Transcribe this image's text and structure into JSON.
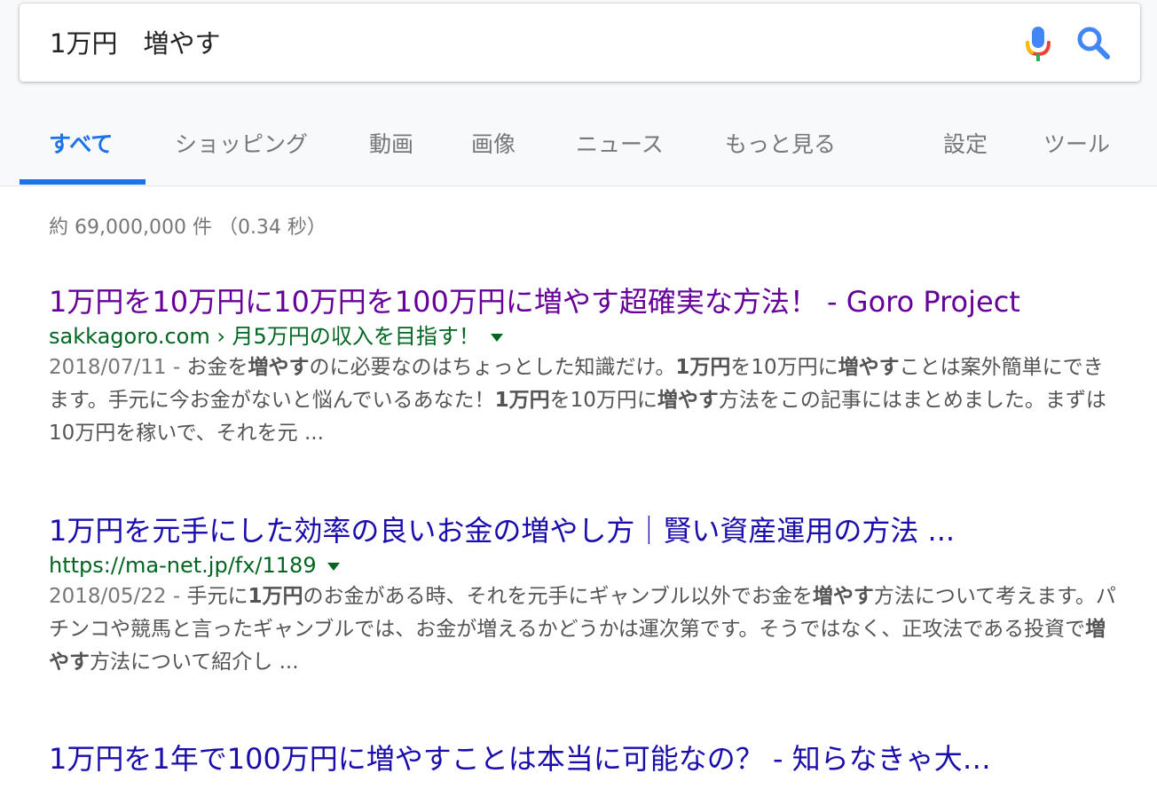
{
  "search": {
    "query": "1万円　増やす"
  },
  "tabs": [
    {
      "label": "すべて",
      "active": true
    },
    {
      "label": "ショッピング"
    },
    {
      "label": "動画"
    },
    {
      "label": "画像"
    },
    {
      "label": "ニュース"
    },
    {
      "label": "もっと見る"
    },
    {
      "label": "設定"
    },
    {
      "label": "ツール"
    }
  ],
  "stats": "約 69,000,000 件 （0.34 秒）",
  "results": [
    {
      "title": "1万円を10万円に10万円を100万円に増やす超確実な方法！ - Goro Project",
      "url": "sakkagoro.com › 月5万円の収入を目指す！",
      "date": "2018/07/11 - ",
      "snippet_parts": [
        [
          "お金を",
          false
        ],
        [
          "増やす",
          true
        ],
        [
          "のに必要なのはちょっとした知識だけ。",
          false
        ],
        [
          "1万円",
          true
        ],
        [
          "を10万円に",
          false
        ],
        [
          "増やす",
          true
        ],
        [
          "ことは案外簡単にできます。手元に今お金がないと悩んでいるあなた！",
          false
        ],
        [
          "1万円",
          true
        ],
        [
          "を10万円に",
          false
        ],
        [
          "増やす",
          true
        ],
        [
          "方法をこの記事にはまとめました。まずは10万円を稼いで、それを元 ...",
          false
        ]
      ]
    },
    {
      "title": "1万円を元手にした効率の良いお金の増やし方｜賢い資産運用の方法 ...",
      "url": "https://ma-net.jp/fx/1189",
      "date": "2018/05/22 - ",
      "snippet_parts": [
        [
          "手元に",
          false
        ],
        [
          "1万円",
          true
        ],
        [
          "のお金がある時、それを元手にギャンブル以外でお金を",
          false
        ],
        [
          "増やす",
          true
        ],
        [
          "方法について考えます。パチンコや競馬と言ったギャンブルでは、お金が増えるかどうかは運次第です。そうではなく、正攻法である投資で",
          false
        ],
        [
          "増やす",
          true
        ],
        [
          "方法について紹介し ...",
          false
        ]
      ]
    },
    {
      "title": "1万円を1年で100万円に増やすことは本当に可能なの？ - 知らなきゃ大…",
      "url": "",
      "date": "",
      "snippet_parts": []
    }
  ],
  "colors": {
    "accent": "#1a73e8",
    "visited_link": "#660099",
    "link": "#1a0dab",
    "url_green": "#006621"
  }
}
